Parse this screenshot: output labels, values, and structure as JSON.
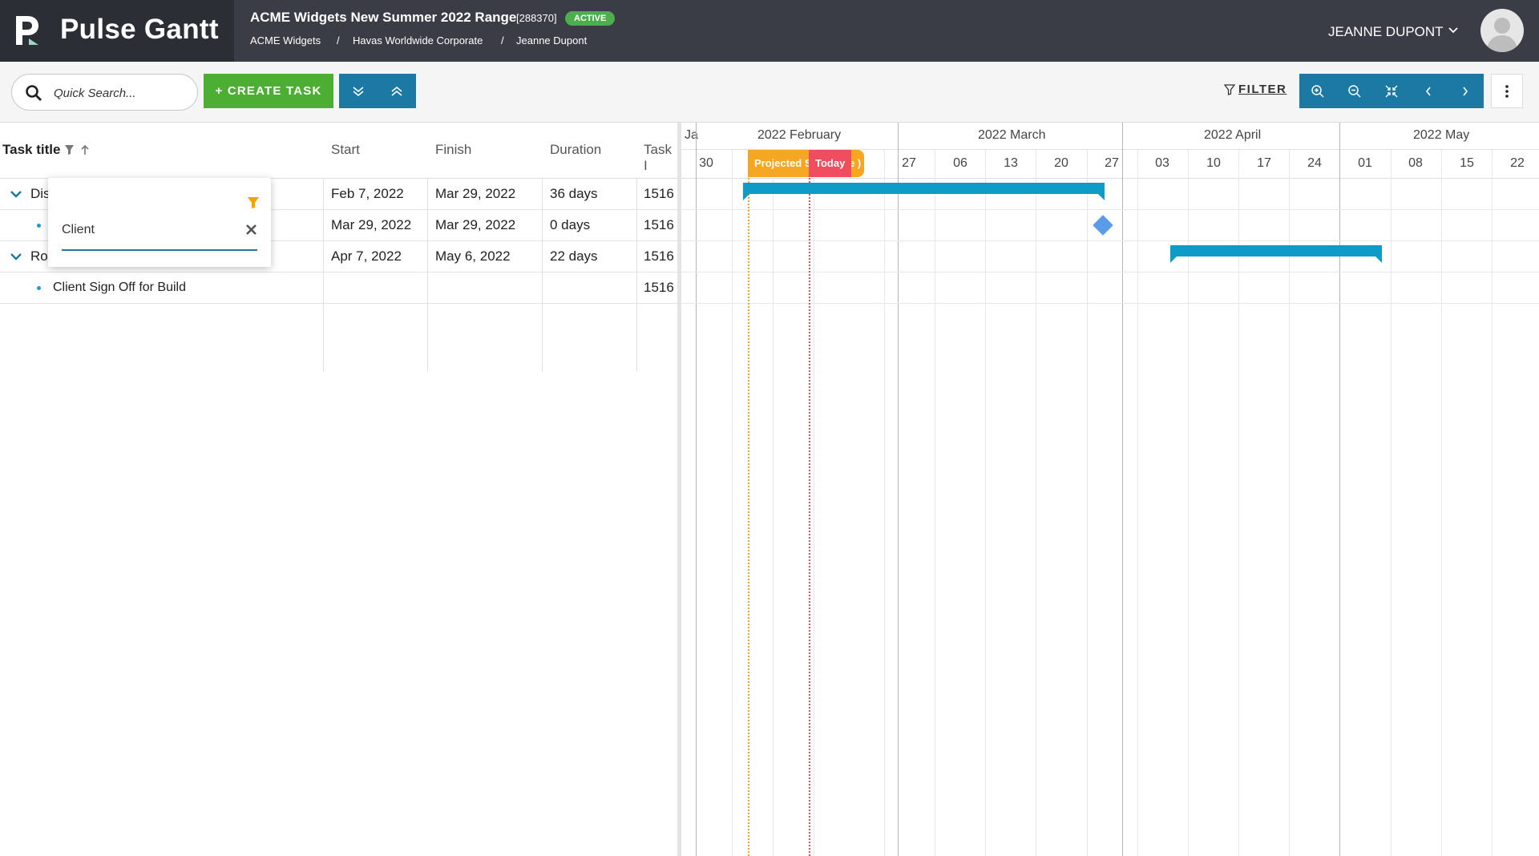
{
  "app": {
    "name": "Pulse Gantt"
  },
  "project": {
    "title": "ACME Widgets New Summer 2022 Range",
    "id": "[288370]",
    "status": "ACTIVE",
    "breadcrumbs": [
      "ACME Widgets",
      "Havas Worldwide Corporate",
      "Jeanne Dupont"
    ],
    "breadcrumb_sep": "/"
  },
  "user": {
    "name": "JEANNE DUPONT"
  },
  "toolbar": {
    "search_placeholder": "Quick Search...",
    "create_label": "+ CREATE TASK",
    "filter_label": "FILTER",
    "icons": [
      "expand-all-icon",
      "collapse-all-icon",
      "zoom-in-icon",
      "zoom-out-icon",
      "zoom-fit-icon",
      "previous-icon",
      "next-icon",
      "more-vertical-icon"
    ]
  },
  "grid": {
    "columns": [
      "Task title",
      "Start",
      "Finish",
      "Duration",
      "Task I"
    ],
    "rows": [
      {
        "title": "Dis",
        "start": "Feb 7, 2022",
        "finish": "Mar 29, 2022",
        "duration": "36 days",
        "task_id": "1516",
        "type": "parent"
      },
      {
        "title": "",
        "start": "Mar 29, 2022",
        "finish": "Mar 29, 2022",
        "duration": "0 days",
        "task_id": "1516",
        "type": "child"
      },
      {
        "title": "Rou",
        "start": "Apr 7, 2022",
        "finish": "May 6, 2022",
        "duration": "22 days",
        "task_id": "1516",
        "type": "parent"
      },
      {
        "title": "Client Sign Off for Build",
        "start": "",
        "finish": "",
        "duration": "",
        "task_id": "1516",
        "type": "child"
      }
    ]
  },
  "filter_popup": {
    "value": "Client"
  },
  "gantt": {
    "months": [
      "Ja",
      "2022 February",
      "2022 March",
      "2022 April",
      "2022 May"
    ],
    "weeks": [
      "30",
      "27",
      "06",
      "13",
      "20",
      "27",
      "03",
      "10",
      "17",
      "24",
      "01",
      "08",
      "15",
      "22"
    ],
    "markers": {
      "projected": "Projected S",
      "projected_tail": "e )",
      "today": "Today"
    }
  },
  "colors": {
    "accent": "#1b79a4",
    "create": "#4cae33",
    "bar": "#0e9bc7",
    "milestone": "#5b9ce8",
    "projected": "#f5a623",
    "today": "#f04e5e"
  }
}
